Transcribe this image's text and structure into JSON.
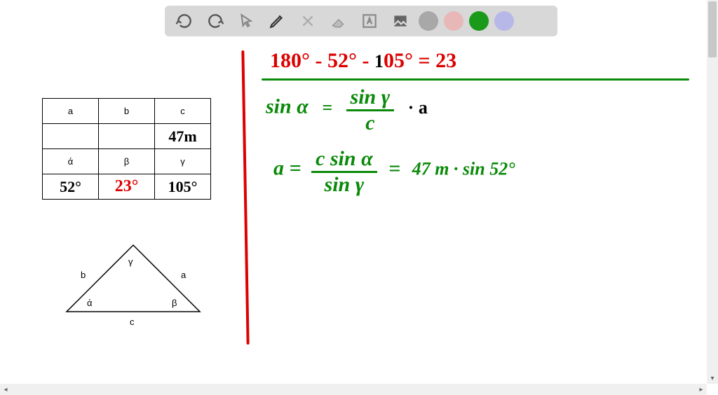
{
  "toolbar": {
    "tools": [
      "undo",
      "redo",
      "pointer",
      "pencil",
      "tools",
      "eraser",
      "text",
      "image"
    ],
    "colors": {
      "gray": "#a8a8a8",
      "pink": "#e8b8b8",
      "green": "#1a9a1a",
      "purple": "#b8b8e8"
    }
  },
  "table": {
    "headers_sides": [
      "a",
      "b",
      "c"
    ],
    "values_sides": [
      "",
      "",
      "47m"
    ],
    "headers_angles": [
      "ά",
      "β",
      "γ"
    ],
    "values_angles": [
      "52°",
      "23°",
      "105°"
    ]
  },
  "triangle": {
    "side_b": "b",
    "side_a": "a",
    "side_c": "c",
    "angle_gamma": "γ",
    "angle_alpha": "ά",
    "angle_beta": "β"
  },
  "equations": {
    "line1_red1": "180° - 52° - ",
    "line1_black": "1",
    "line1_red2": "05° = 23",
    "line2_sin_alpha": "sin α",
    "line2_eq": "=",
    "line2_num": "sin γ",
    "line2_den": "c",
    "line2_dot_a": "· a",
    "line3_a_eq": "a =",
    "line3_num": "c sin α",
    "line3_den": "sin γ",
    "line3_eq2": "=",
    "line3_rhs": "47 m · sin 52°"
  }
}
